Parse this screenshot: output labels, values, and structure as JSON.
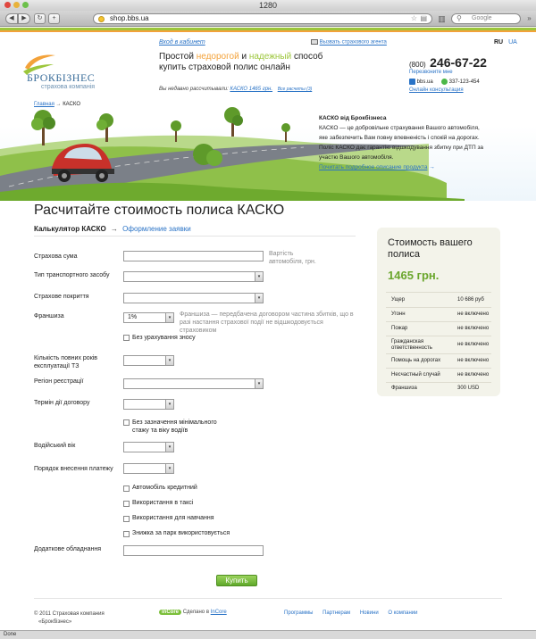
{
  "browser": {
    "window_title": "1280",
    "url": "shop.bbs.ua",
    "search_placeholder": "Google",
    "back_glyph": "◀",
    "forward_glyph": "▶",
    "reload_glyph": "↻",
    "add_glyph": "+",
    "status": "Done"
  },
  "header": {
    "cabinet_link": "Вход в кабинет",
    "tagline_1": "Простой ",
    "tagline_word_1": "недорогой",
    "tagline_2": " и ",
    "tagline_word_2": "надежный",
    "tagline_3": " способ",
    "tagline_line2": "купить страховой полис онлайн",
    "recent_text": "Вы недавно рассчитывали:",
    "recent_link": "КАСКО 1465 грн.",
    "recent_all": "Все расчеты (3)",
    "agent_link": "Вызвать страхового агента",
    "lang_ru": "RU",
    "lang_ua": "UA",
    "phone_prefix": "(800)",
    "phone_number": "246-67-22",
    "callback_link": "Перезвоните мне",
    "skype": "bbs.ua",
    "icq": "337-123-454",
    "consult_link": "Онлайн консультация",
    "logo_name": "БРОКБІЗНЕС",
    "logo_sub": "страхова компанія"
  },
  "breadcrumb": {
    "home": "Главная",
    "arrow": "→",
    "current": "КАСКО"
  },
  "promo": {
    "title": "КАСКО від Брокбізнеса",
    "text": "КАСКО — це добровільне страхування Вашого автомобіля, яке забезпечить Вам повну впевненість і спокій на дорогах. Поліс КАСКО дає гарантію відшкодування збитку при ДТП за участю Вашого автомобіля.",
    "link": "Почитать подробное описание продукта",
    "arrow": "→"
  },
  "page": {
    "title": "Расчитайте стоимость полиса КАСКО",
    "step_active": "Калькулятор КАСКО",
    "step_arrow": "→",
    "step_next": "Оформление заявки"
  },
  "form": {
    "sum_label": "Страхова сума",
    "sum_hint": "Вартість автомобіля, грн.",
    "vehicle_label": "Тип транспортного засобу",
    "coverage_label": "Страхове покриття",
    "franchise_label": "Франшиза",
    "franchise_value": "1%",
    "franchise_hint": "Франшиза — передбачена договором частина збитків, що в разі настання страхової події не відшкодовується страховиком",
    "wear_checkbox": "Без урахування зносу",
    "years_label": "Кількість повних років експлуатації ТЗ",
    "region_label": "Регіон реєстрації",
    "term_label": "Термін дії договору",
    "nolimit_checkbox": "Без зазначення мінімального стажу та віку водіїв",
    "driver_age_label": "Водійський вік",
    "payment_label": "Порядок внесення платежу",
    "credit_checkbox": "Автомобіль кредитний",
    "taxi_checkbox": "Використання в таксі",
    "training_checkbox": "Використання для навчання",
    "fleet_checkbox": "Знижка за парк використовується",
    "equipment_label": "Додаткове обладнання",
    "select_arrow": "▾",
    "buy_button": "Купить"
  },
  "panel": {
    "title": "Стоимость вашего полиса",
    "price": "1465 грн.",
    "rows": [
      {
        "k": "Ущер",
        "v": "10 686 руб"
      },
      {
        "k": "Угонн",
        "v": "не включено"
      },
      {
        "k": "Пожар",
        "v": "не включено"
      },
      {
        "k": "Гражданская ответственность",
        "v": "не включено"
      },
      {
        "k": "Помощь на дорогах",
        "v": "не включено"
      },
      {
        "k": "Несчастный случай",
        "v": "не включено"
      },
      {
        "k": "Франшиза",
        "v": "300 USD"
      }
    ]
  },
  "footer": {
    "copyright_1": "© 2011 Страховая компания",
    "copyright_2": "«Брокбізнес»",
    "made_in": "Сделано в",
    "made_link": "InCore",
    "made_logo": "inCore",
    "links": [
      "Программы",
      "Партнерам",
      "Новини",
      "О компании"
    ]
  },
  "colors": {
    "accent_green": "#9cc63b",
    "accent_orange": "#f3a23a",
    "link_blue": "#2a73c6",
    "price_green": "#6aa62c"
  }
}
